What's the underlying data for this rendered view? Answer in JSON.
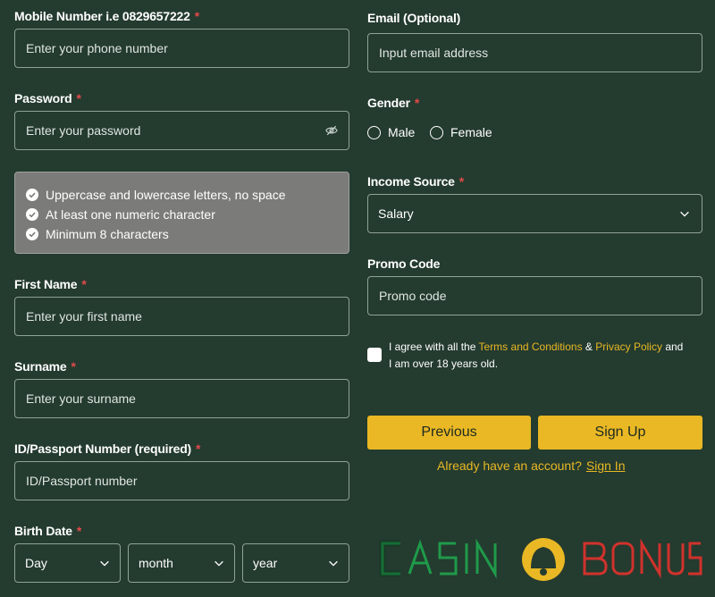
{
  "form": {
    "mobile": {
      "label": "Mobile Number i.e 0829657222",
      "required": "*",
      "placeholder": "Enter your phone number"
    },
    "password": {
      "label": "Password",
      "required": "*",
      "placeholder": "Enter your password"
    },
    "password_rules": [
      "Uppercase and lowercase letters, no space",
      "At least one numeric character",
      "Minimum 8 characters"
    ],
    "first_name": {
      "label": "First Name",
      "required": "*",
      "placeholder": "Enter your first name"
    },
    "surname": {
      "label": "Surname",
      "required": "*",
      "placeholder": "Enter your surname"
    },
    "id_number": {
      "label": "ID/Passport Number (required)",
      "required": "*",
      "placeholder": "ID/Passport number"
    },
    "birth_date": {
      "label": "Birth Date",
      "required": "*",
      "day": "Day",
      "month": "month",
      "year": "year"
    },
    "email": {
      "label": "Email (Optional)",
      "placeholder": "Input email address"
    },
    "gender": {
      "label": "Gender",
      "required": "*",
      "options": [
        "Male",
        "Female"
      ]
    },
    "income_source": {
      "label": "Income Source",
      "required": "*",
      "value": "Salary"
    },
    "promo": {
      "label": "Promo Code",
      "placeholder": "Promo code"
    },
    "agree": {
      "prefix": "I agree with all the",
      "terms": "Terms and Conditions",
      "amp": "&",
      "privacy": "Privacy Policy",
      "suffix": "and",
      "line2": "I am over 18 years old."
    },
    "buttons": {
      "previous": "Previous",
      "signup": "Sign Up"
    },
    "account": {
      "text": "Already have an account?",
      "signin": "Sign In"
    }
  },
  "colors": {
    "background": "#243b2f",
    "accent": "#e9b824",
    "required": "#e24a4a"
  },
  "icons": {
    "password_toggle": "eye-slash-icon",
    "rule_check": "check-circle-icon",
    "select": "chevron-down-icon"
  }
}
